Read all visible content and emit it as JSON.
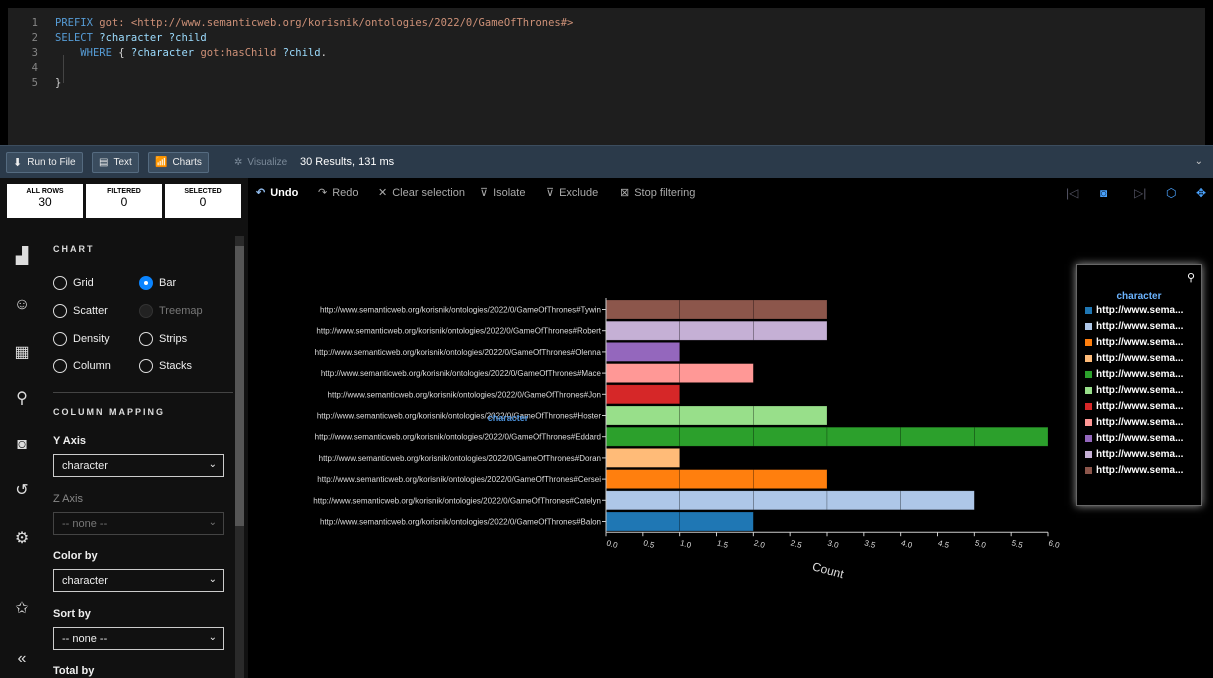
{
  "editor": {
    "lines": [
      {
        "n": "1",
        "parts": [
          [
            "kw",
            "PREFIX "
          ],
          [
            "pre",
            "got: "
          ],
          [
            "pre",
            "<http://www.semanticweb.org/korisnik/ontologies/2022/0/GameOfThrones#>"
          ]
        ]
      },
      {
        "n": "2",
        "parts": [
          [
            "kw",
            "SELECT "
          ],
          [
            "var",
            "?character ?child"
          ]
        ]
      },
      {
        "n": "3",
        "parts": [
          [
            "plain",
            "    "
          ],
          [
            "kw",
            "WHERE "
          ],
          [
            "plain",
            "{ "
          ],
          [
            "var",
            "?character "
          ],
          [
            "pre",
            "got:"
          ],
          [
            "pre",
            "hasChild "
          ],
          [
            "var",
            "?child"
          ],
          [
            "plain",
            "."
          ]
        ]
      },
      {
        "n": "4",
        "parts": []
      },
      {
        "n": "5",
        "parts": [
          [
            "plain",
            "}"
          ]
        ]
      }
    ]
  },
  "toolbar": {
    "run_to_file": "Run to File",
    "text": "Text",
    "charts": "Charts",
    "visualize": "Visualize",
    "results": "30 Results,  131 ms"
  },
  "counts": {
    "all_rows_label": "ALL ROWS",
    "all_rows": "30",
    "filtered_label": "FILTERED",
    "filtered": "0",
    "selected_label": "SELECTED",
    "selected": "0"
  },
  "panel": {
    "chart_title": "CHART",
    "chart_types": {
      "grid": "Grid",
      "bar": "Bar",
      "scatter": "Scatter",
      "treemap": "Treemap",
      "density": "Density",
      "strips": "Strips",
      "column": "Column",
      "stacks": "Stacks"
    },
    "mapping_title": "COLUMN MAPPING",
    "y_axis_label": "Y Axis",
    "y_axis_value": "character",
    "z_axis_label": "Z Axis",
    "z_axis_value": "-- none --",
    "color_by_label": "Color by",
    "color_by_value": "character",
    "sort_by_label": "Sort by",
    "sort_by_value": "-- none --",
    "total_by_label": "Total by"
  },
  "actions": {
    "undo": "Undo",
    "redo": "Redo",
    "clear": "Clear selection",
    "isolate": "Isolate",
    "exclude": "Exclude",
    "stop": "Stop filtering"
  },
  "legend": {
    "title": "character",
    "item_label": "http://www.sema..."
  },
  "chart_data": {
    "type": "bar",
    "orientation": "horizontal",
    "stacked_segments": "unit",
    "y_axis_label": "character",
    "xlabel": "Count",
    "xlim": [
      0,
      6
    ],
    "x_ticks": [
      "0.0",
      "0.5",
      "1.0",
      "1.5",
      "2.0",
      "2.5",
      "3.0",
      "3.5",
      "4.0",
      "4.5",
      "5.0",
      "5.5",
      "6.0"
    ],
    "categories": [
      "http://www.semanticweb.org/korisnik/ontologies/2022/0/GameOfThrones#Tywin",
      "http://www.semanticweb.org/korisnik/ontologies/2022/0/GameOfThrones#Robert",
      "http://www.semanticweb.org/korisnik/ontologies/2022/0/GameOfThrones#Olenna",
      "http://www.semanticweb.org/korisnik/ontologies/2022/0/GameOfThrones#Mace",
      "http://www.semanticweb.org/korisnik/ontologies/2022/0/GameOfThrones#Jon",
      "http://www.semanticweb.org/korisnik/ontologies/2022/0/GameOfThrones#Hoster",
      "http://www.semanticweb.org/korisnik/ontologies/2022/0/GameOfThrones#Eddard",
      "http://www.semanticweb.org/korisnik/ontologies/2022/0/GameOfThrones#Doran",
      "http://www.semanticweb.org/korisnik/ontologies/2022/0/GameOfThrones#Cersei",
      "http://www.semanticweb.org/korisnik/ontologies/2022/0/GameOfThrones#Catelyn",
      "http://www.semanticweb.org/korisnik/ontologies/2022/0/GameOfThrones#Balon"
    ],
    "values": [
      3,
      3,
      1,
      2,
      1,
      3,
      6,
      1,
      3,
      5,
      2
    ],
    "colors": [
      "#8c564b",
      "#c5b0d5",
      "#9467bd",
      "#ff9896",
      "#d62728",
      "#98df8a",
      "#2ca02c",
      "#ffbb78",
      "#ff7f0e",
      "#aec7e8",
      "#1f77b4"
    ],
    "legend_colors": [
      "#1f77b4",
      "#aec7e8",
      "#ff7f0e",
      "#ffbb78",
      "#2ca02c",
      "#98df8a",
      "#d62728",
      "#ff9896",
      "#9467bd",
      "#c5b0d5",
      "#8c564b"
    ]
  }
}
